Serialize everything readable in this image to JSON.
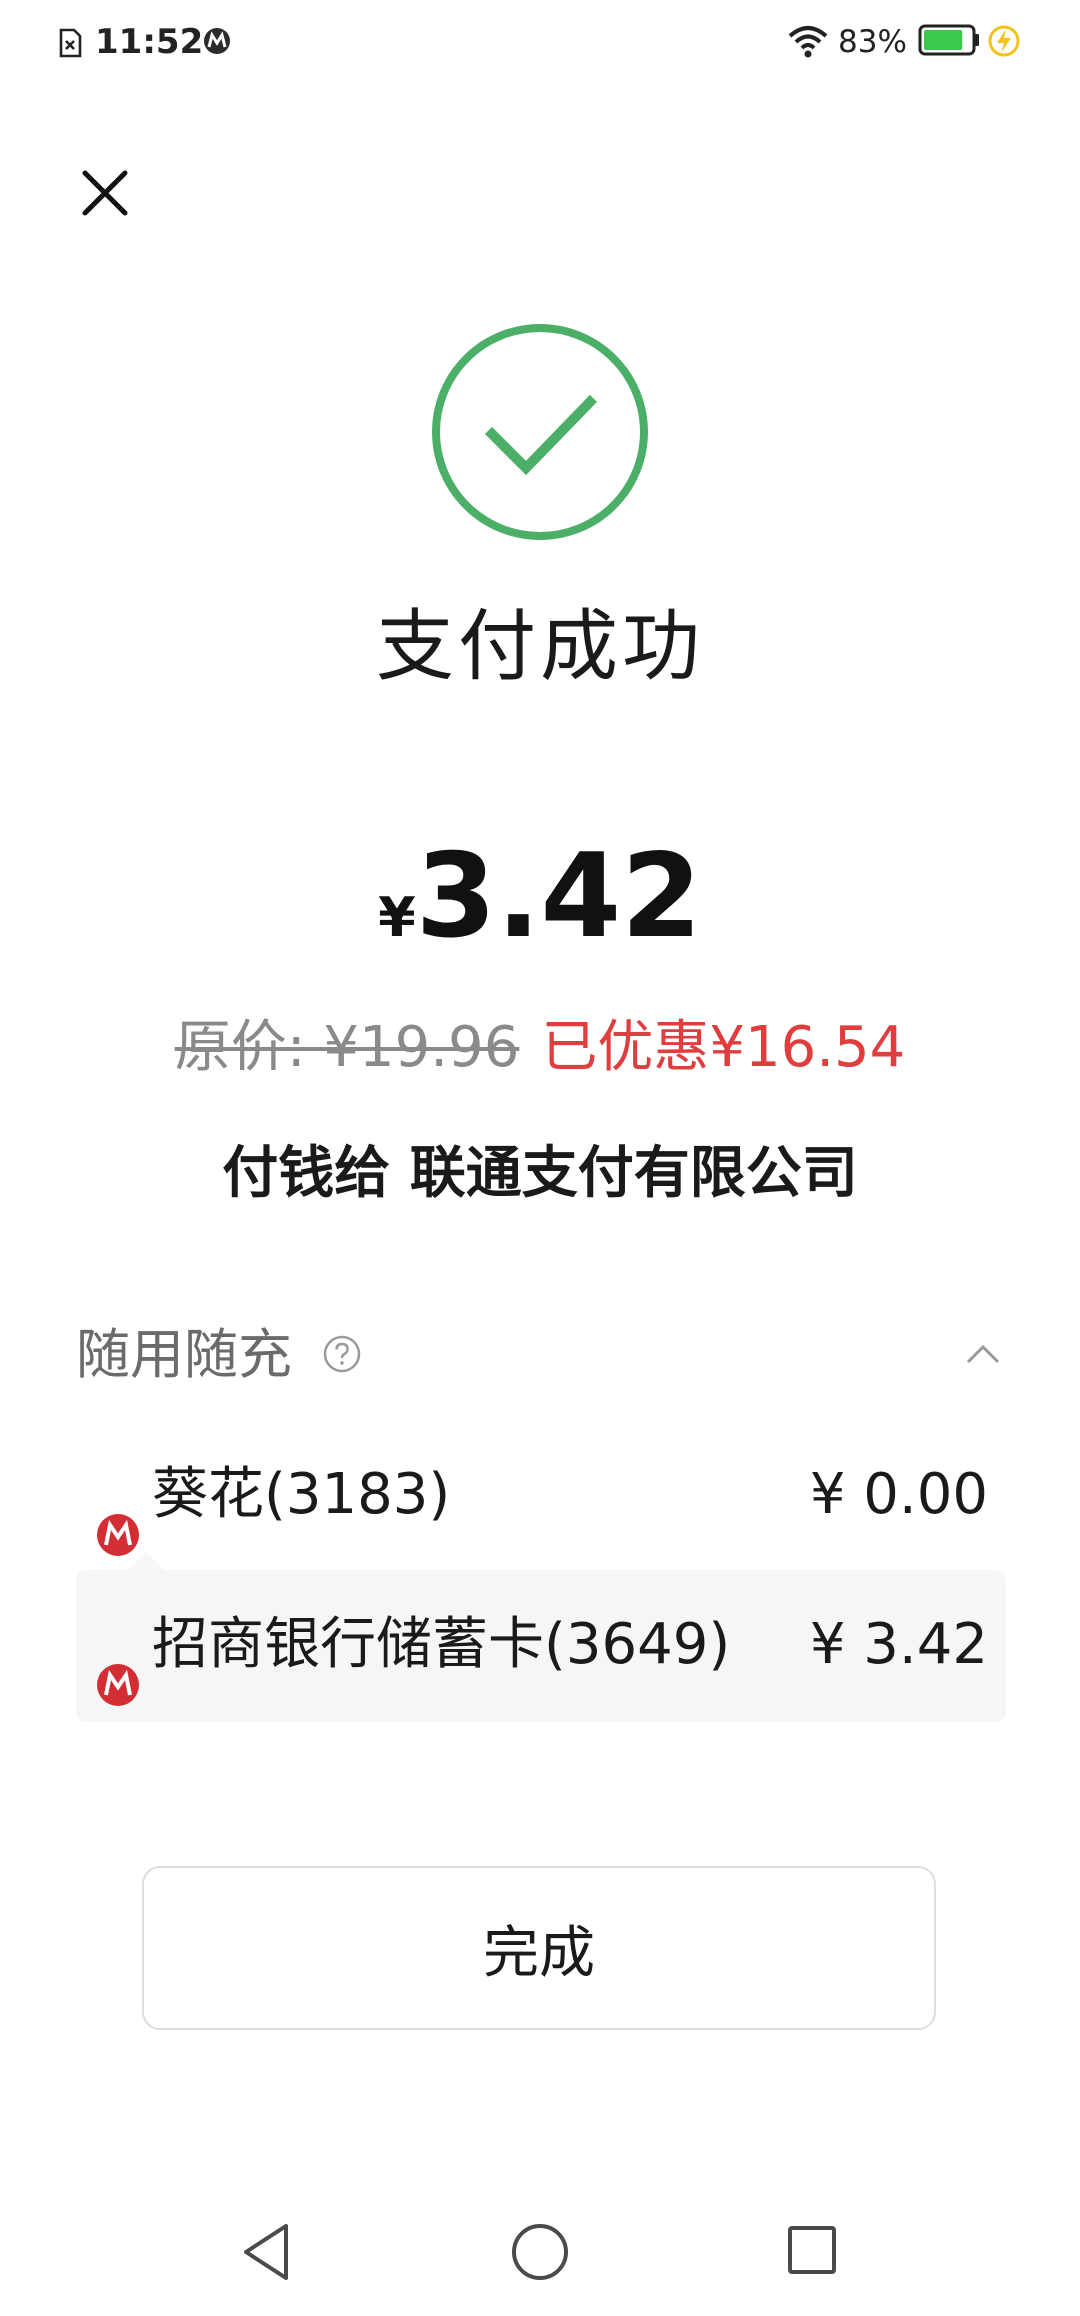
{
  "status_bar": {
    "time": "11:52",
    "battery_percent": "83%",
    "battery_level": 0.83,
    "charging": true,
    "icons": [
      "sim-card-icon",
      "bank-app-icon",
      "wifi-icon",
      "battery-icon",
      "charging-bolt-icon"
    ]
  },
  "header": {
    "close_icon": "close-icon"
  },
  "result": {
    "icon": "success-check-icon",
    "title": "支付成功",
    "currency_symbol": "¥",
    "amount": "3.42",
    "original_price": "原价: ¥19.96",
    "discount_text": "已优惠¥16.54",
    "payee": "付钱给 联通支付有限公司"
  },
  "payment_breakdown": {
    "section_title": "随用随充",
    "help_icon": "help-icon",
    "expand_icon": "chevron-up-icon",
    "items": [
      {
        "logo": "bank-logo-icon",
        "name": "葵花(3183)",
        "amount": "¥ 0.00"
      },
      {
        "logo": "bank-logo-icon",
        "name": "招商银行储蓄卡(3649)",
        "amount": "¥ 3.42"
      }
    ]
  },
  "actions": {
    "done_label": "完成"
  },
  "nav_bar": {
    "icons": [
      "back-icon",
      "home-icon",
      "recent-apps-icon"
    ]
  },
  "colors": {
    "success_green": "#4caf68",
    "discount_red": "#e03e3e",
    "bank_logo_red": "#d42e35",
    "battery_green": "#3cc84a",
    "charge_yellow": "#f3c21a"
  }
}
